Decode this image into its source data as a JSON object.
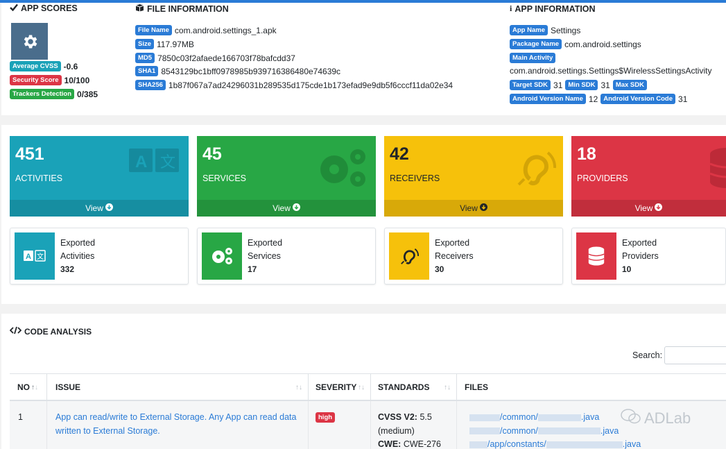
{
  "colors": {
    "primary": "#2a7bd6",
    "teal": "#1aa2b8",
    "green": "#28a745",
    "yellow": "#f6c10b",
    "red": "#dc3545",
    "slate": "#4a6d8c"
  },
  "app_scores": {
    "title": "APP SCORES",
    "icon": "check-icon",
    "average_cvss_label": "Average CVSS",
    "average_cvss_value": "-0.6",
    "security_score_label": "Security Score",
    "security_score_value": "10/100",
    "trackers_label": "Trackers Detection",
    "trackers_value": "0/385"
  },
  "file_info": {
    "title": "FILE INFORMATION",
    "icon": "box-icon",
    "rows": [
      {
        "label": "File Name",
        "value": "com.android.settings_1.apk"
      },
      {
        "label": "Size",
        "value": "117.97MB"
      },
      {
        "label": "MD5",
        "value": "7850c03f2afaede166703f78bafcdd37"
      },
      {
        "label": "SHA1",
        "value": "8543129bc1bff0978985b939716386480e74639c"
      },
      {
        "label": "SHA256",
        "value": "1b87f067a7ad24296031b289535d175cde1b173efad9e9db5f6cccf11da02e34"
      }
    ]
  },
  "app_info": {
    "title": "APP INFORMATION",
    "icon": "info-icon",
    "app_name_label": "App Name",
    "app_name_value": "Settings",
    "package_label": "Package Name",
    "package_value": "com.android.settings",
    "main_activity_label": "Main Activity",
    "main_activity_value": "com.android.settings.Settings$WirelessSettingsActivity",
    "target_sdk_label": "Target SDK",
    "target_sdk_value": "31",
    "min_sdk_label": "Min SDK",
    "min_sdk_value": "31",
    "max_sdk_label": "Max SDK",
    "version_name_label": "Android Version Name",
    "version_name_value": "12",
    "version_code_label": "Android Version Code",
    "version_code_value": "31"
  },
  "tiles": [
    {
      "count": "451",
      "label": "ACTIVITIES",
      "view": "View",
      "icon": "translate-icon"
    },
    {
      "count": "45",
      "label": "SERVICES",
      "view": "View",
      "icon": "cogs-icon"
    },
    {
      "count": "42",
      "label": "RECEIVERS",
      "view": "View",
      "icon": "ear-icon"
    },
    {
      "count": "18",
      "label": "PROVIDERS",
      "view": "View",
      "icon": "database-icon"
    }
  ],
  "exported": [
    {
      "line1": "Exported",
      "line2": "Activities",
      "count": "332",
      "icon": "translate-icon"
    },
    {
      "line1": "Exported",
      "line2": "Services",
      "count": "17",
      "icon": "cogs-icon"
    },
    {
      "line1": "Exported",
      "line2": "Receivers",
      "count": "30",
      "icon": "ear-icon"
    },
    {
      "line1": "Exported",
      "line2": "Providers",
      "count": "10",
      "icon": "database-icon"
    }
  ],
  "code_analysis": {
    "title": "CODE ANALYSIS",
    "icon": "code-icon",
    "search_label": "Search:",
    "search_value": "",
    "columns": [
      "NO",
      "ISSUE",
      "SEVERITY",
      "STANDARDS",
      "FILES"
    ],
    "rows": [
      {
        "no": "1",
        "issue": "App can read/write to External Storage. Any App can read data written to External Storage.",
        "severity": "high",
        "standard_cvss_label": "CVSS V2:",
        "standard_cvss_value": "5.5",
        "standard_cvss_level": "(medium)",
        "standard_cwe_label": "CWE:",
        "standard_cwe_value": "CWE-276",
        "files": [
          "/common/",
          ".java",
          "/common/",
          ".java",
          "/app/constants/",
          ".java"
        ]
      }
    ]
  },
  "watermark": {
    "text": "ADLab"
  }
}
